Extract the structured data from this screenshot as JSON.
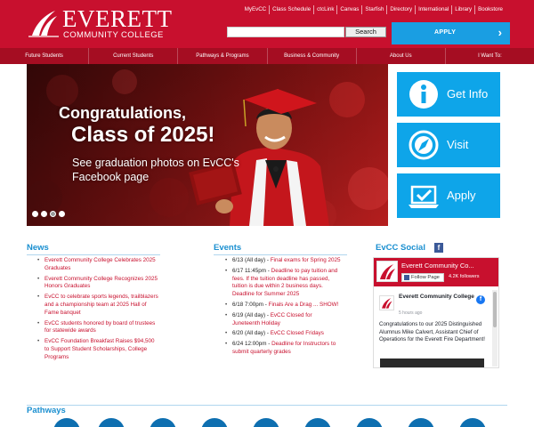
{
  "brand": {
    "name": "EVERETT",
    "tagline": "COMMUNITY COLLEGE",
    "red": "#c8102e",
    "blue": "#1a9ee2"
  },
  "toplinks": [
    "MyEvCC",
    "Class Schedule",
    "ctcLink",
    "Canvas",
    "Starfish",
    "Directory",
    "International",
    "Library",
    "Bookstore"
  ],
  "search": {
    "placeholder": "",
    "button": "Search"
  },
  "apply_button": "APPLY",
  "nav": [
    "Future Students",
    "Current Students",
    "Pathways & Programs",
    "Business & Community",
    "About Us",
    "I Want To:"
  ],
  "hero": {
    "line1": "Congratulations,",
    "line2": "Class of 2025!",
    "line3": "See graduation photos on EvCC's Facebook page"
  },
  "tiles": [
    {
      "label": "Get Info",
      "icon": "info-icon"
    },
    {
      "label": "Visit",
      "icon": "compass-icon"
    },
    {
      "label": "Apply",
      "icon": "laptop-icon"
    }
  ],
  "news": {
    "title": "News",
    "items": [
      "Everett Community College Celebrates 2025 Graduates",
      "Everett Community College Recognizes 2025 Honors Graduates",
      "EvCC to celebrate sports legends, trailblazers and a championship team at 2025 Hall of Fame banquet",
      "EvCC students honored by board of trustees for statewide awards",
      "EvCC Foundation Breakfast Raises $94,500 to Support Student Scholarships, College Programs"
    ]
  },
  "events": {
    "title": "Events",
    "items": [
      {
        "date": "6/13 (All day) - ",
        "text": "Final exams for Spring 2025"
      },
      {
        "date": "6/17 11:45pm - ",
        "text": "Deadline to pay tuition and fees. If the tuition deadline has passed, tuition is due within 2 business days. Deadline for Summer 2025"
      },
      {
        "date": "6/18 7:00pm - ",
        "text": "Finals Are a Drag ... SHOW!"
      },
      {
        "date": "6/19 (All day) - ",
        "text": "EvCC Closed for Juneteenth Holiday"
      },
      {
        "date": "6/20 (All day) - ",
        "text": "EvCC Closed Fridays"
      },
      {
        "date": "6/24 12:00pm - ",
        "text": "Deadline for Instructors to submit quarterly grades"
      }
    ]
  },
  "social": {
    "title": "EvCC Social",
    "page_name": "Everett Community Co...",
    "like_label": "Follow Page",
    "followers": "4.2K followers",
    "post_author": "Everett Community College",
    "post_time": "5 hours ago",
    "post_text": "Congratulations to our 2025 Distinguished Alumnus Mike Calvert, Assistant Chief of Operations for the Everett Fire Department!"
  },
  "pathways": {
    "title": "Pathways"
  }
}
